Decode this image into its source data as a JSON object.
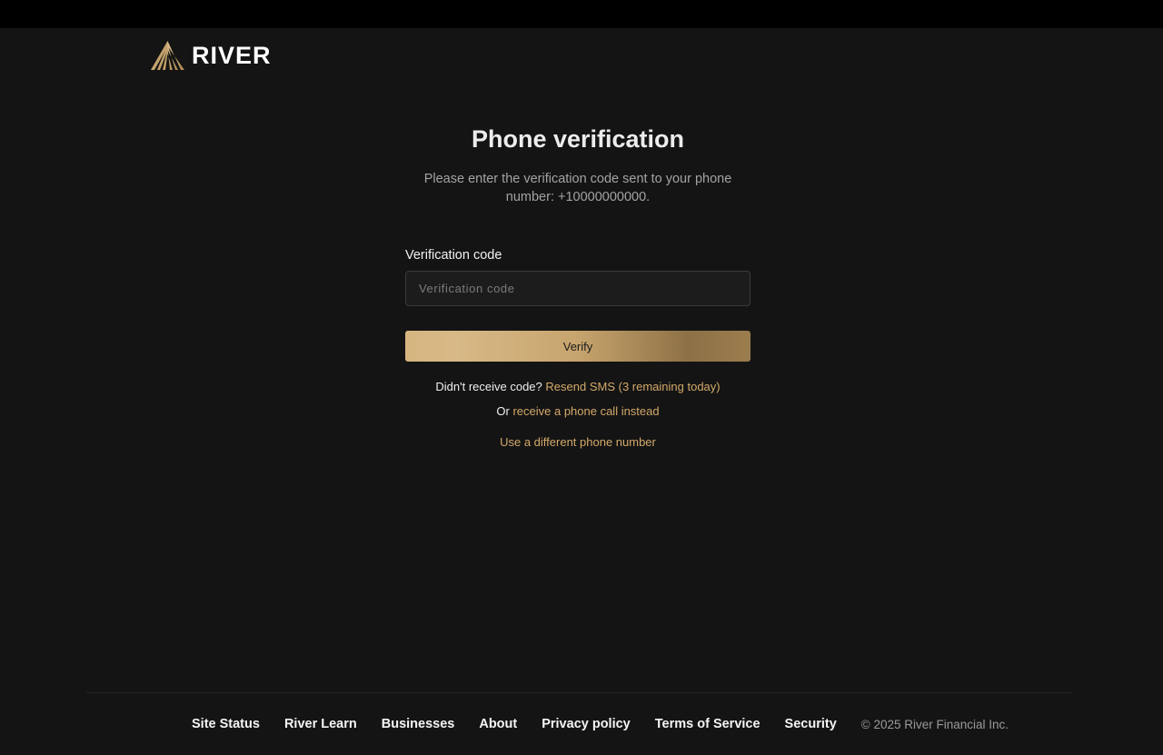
{
  "brand": {
    "name": "RIVER",
    "accent_color": "#d4a96a"
  },
  "main": {
    "title": "Phone verification",
    "subtitle": "Please enter the verification code sent to your phone number: +10000000000.",
    "field_label": "Verification code",
    "input": {
      "value": "",
      "placeholder": "Verification code"
    },
    "verify_label": "Verify",
    "resend_prefix": "Didn't receive code?",
    "resend_link": "Resend SMS (3 remaining today)",
    "call_prefix": "Or",
    "call_link": "receive a phone call instead",
    "different_number_link": "Use a different phone number"
  },
  "footer": {
    "links": [
      "Site Status",
      "River Learn",
      "Businesses",
      "About",
      "Privacy policy",
      "Terms of Service",
      "Security"
    ],
    "copyright": "© 2025 River Financial Inc."
  }
}
